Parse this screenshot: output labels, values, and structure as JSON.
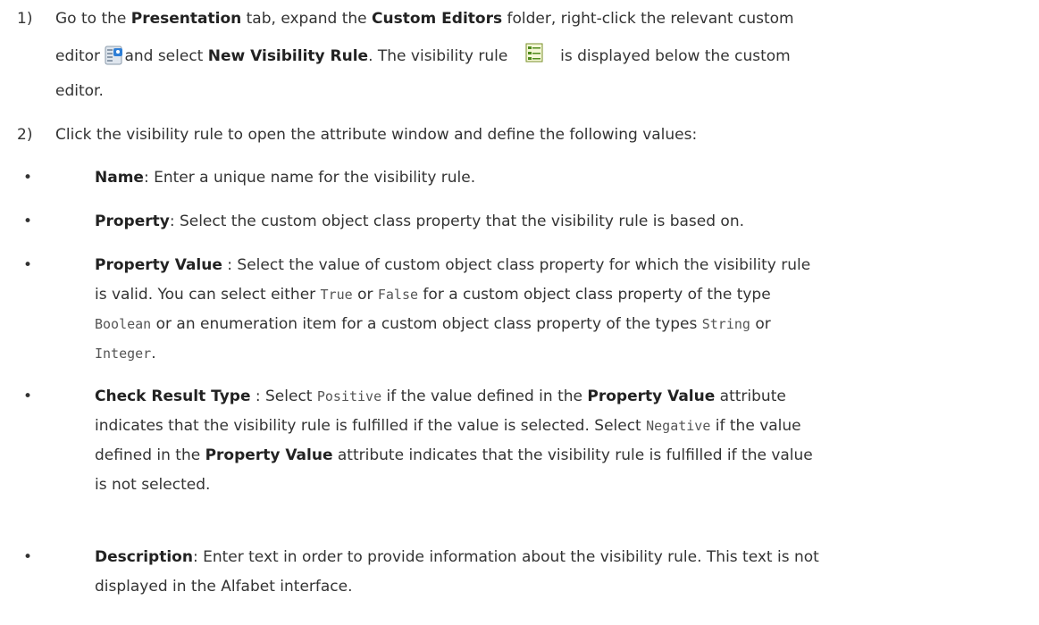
{
  "steps": [
    {
      "number": "1)",
      "line1": {
        "t1": "Go to the ",
        "b1": "Presentation",
        "t2": " tab, expand the ",
        "b2": "Custom Editors",
        "t3": " folder, right-click the relevant custom"
      },
      "line2": {
        "t1": "editor ",
        "t2": "and select ",
        "b1": "New Visibility Rule",
        "t3": ". The visibility rule ",
        "t4": " is displayed below the custom"
      },
      "line3": "editor.",
      "icons": [
        "custom-editor-icon",
        "visibility-rule-icon"
      ]
    },
    {
      "number": "2)",
      "line1": "Click the visibility rule to open the attribute window and define the following values:"
    }
  ],
  "bullets": [
    {
      "bold": "Name",
      "text": ": Enter a unique name for the visibility rule."
    },
    {
      "bold": "Property",
      "text": ": Select the custom object class property that the visibility rule is based on."
    },
    {
      "bold": "Property Value",
      "l1": " : Select the value of custom object class property for which the visibility rule",
      "l2a": "is valid. You can select either ",
      "c1": "True",
      "l2b": " or ",
      "c2": "False",
      "l2c": " for a custom object class property of the type",
      "c3": "Boolean",
      "l3a": " or an enumeration item for a custom object class property of the types ",
      "c4": "String",
      "l3b": " or",
      "c5": "Integer",
      "l4a": "."
    },
    {
      "bold": "Check Result Type",
      "l1a": " : Select ",
      "c1": "Positive",
      "l1b": " if the value defined in the ",
      "b2": "Property Value",
      "l1c": " attribute",
      "l2a": "indicates that the visibility rule is fulfilled if the value is selected. Select ",
      "c2": "Negative",
      "l2b": " if the value",
      "l3a": "defined in the ",
      "b3": "Property Value",
      "l3b": " attribute indicates that the visibility rule is fulfilled if the value",
      "l4": "is not selected."
    },
    {
      "bold": "Description",
      "l1": ": Enter text in order to provide information about the visibility rule. This text is not",
      "l2": "displayed in the Alfabet interface."
    }
  ],
  "colors": {
    "text": "#333333",
    "bold": "#222222",
    "mono": "#555555"
  }
}
